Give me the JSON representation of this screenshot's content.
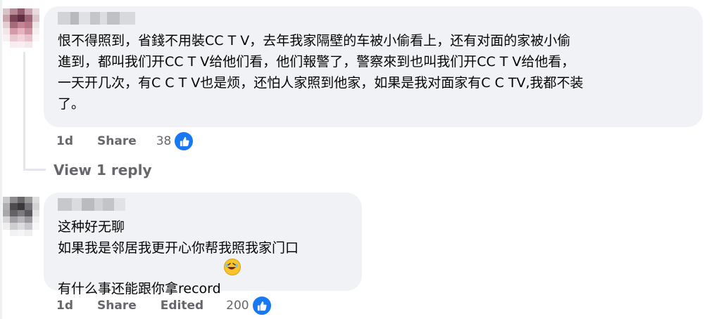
{
  "comments": [
    {
      "author_blurred": true,
      "text": "恨不得照到，省錢不用裝CC T V，去年我家隔壁的车被小偷看上，还有对面的家被小偷\n進到，都叫我们开CC T V给他们看，他们報警了，警察來到也叫我们开CC T V给他看，\n一天开几次，有C C T V也是烦，还怕人家照到他家，如果是我对面家有C C TV,我都不装\n了。",
      "time": "1d",
      "share_label": "Share",
      "reaction_count": "38",
      "reaction_icon": "like-icon",
      "view_replies_label": "View 1 reply"
    },
    {
      "author_blurred": true,
      "text": "这种好无聊\n如果我是邻居我更开心你帮我照我家门口\n有什么事还能跟你拿record",
      "emoji": "rolling-on-floor-laughing-emoji",
      "time": "1d",
      "share_label": "Share",
      "edited_label": "Edited",
      "reaction_count": "200",
      "reaction_icon": "like-icon"
    }
  ],
  "colors": {
    "bubble": "#f0f2f5",
    "text": "#050505",
    "meta": "#65676b",
    "like": "#1877f2"
  }
}
